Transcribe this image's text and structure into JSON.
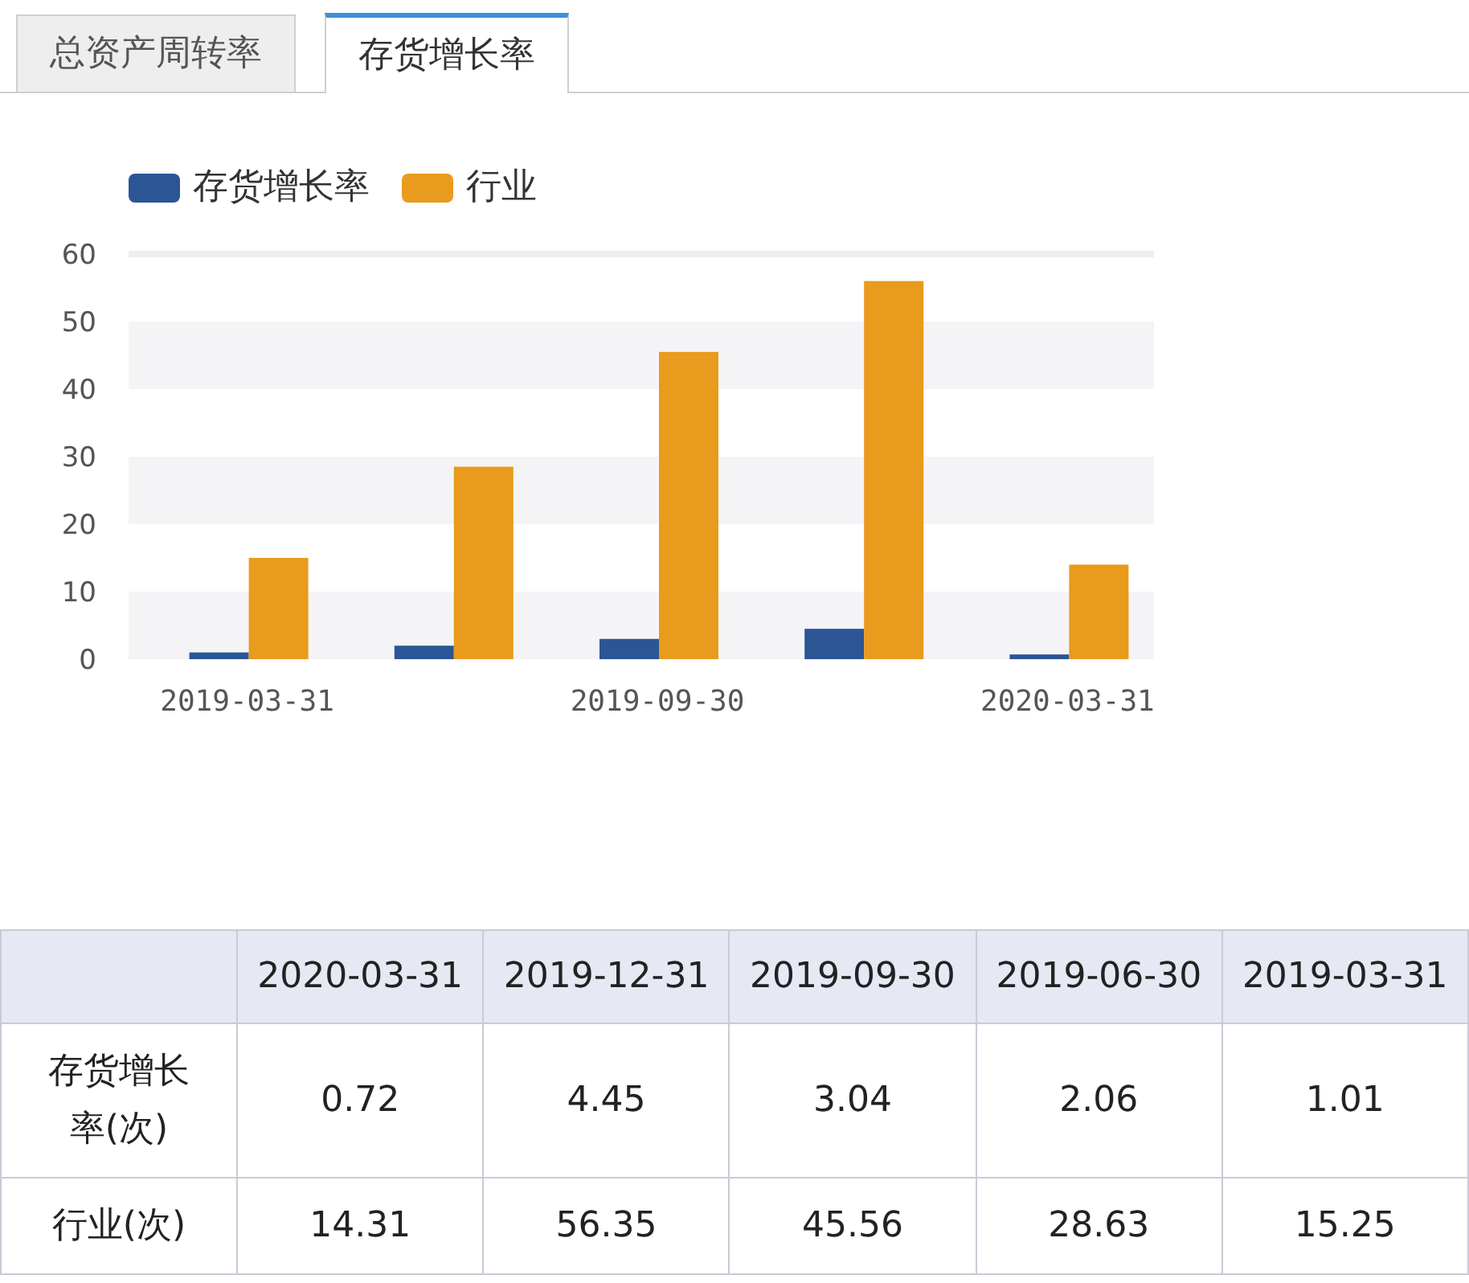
{
  "tabs": [
    {
      "label": "总资产周转率",
      "selected": false
    },
    {
      "label": "存货增长率",
      "selected": true
    }
  ],
  "chart_data": {
    "type": "bar",
    "categories": [
      "2019-03-31",
      null,
      "2019-09-30",
      null,
      "2020-03-31"
    ],
    "legend": "top",
    "yticks": [
      0,
      10,
      20,
      30,
      40,
      50,
      60
    ],
    "ylim": [
      0,
      60
    ],
    "series": [
      {
        "name": "存货增长率",
        "color": "#2c5596",
        "values": [
          1,
          2,
          3,
          4.5,
          0.7
        ]
      },
      {
        "name": "行业",
        "color": "#e89b1c",
        "values": [
          15,
          28.5,
          45.5,
          56,
          14
        ]
      }
    ]
  },
  "table": {
    "columns": [
      "2020-03-31",
      "2019-12-31",
      "2019-09-30",
      "2019-06-30",
      "2019-03-31"
    ],
    "rows": [
      {
        "label": "存货增长率(次)",
        "cells": [
          "0.72",
          "4.45",
          "3.04",
          "2.06",
          "1.01"
        ]
      },
      {
        "label": "行业(次)",
        "cells": [
          "14.31",
          "56.35",
          "45.56",
          "28.63",
          "15.25"
        ]
      }
    ]
  }
}
